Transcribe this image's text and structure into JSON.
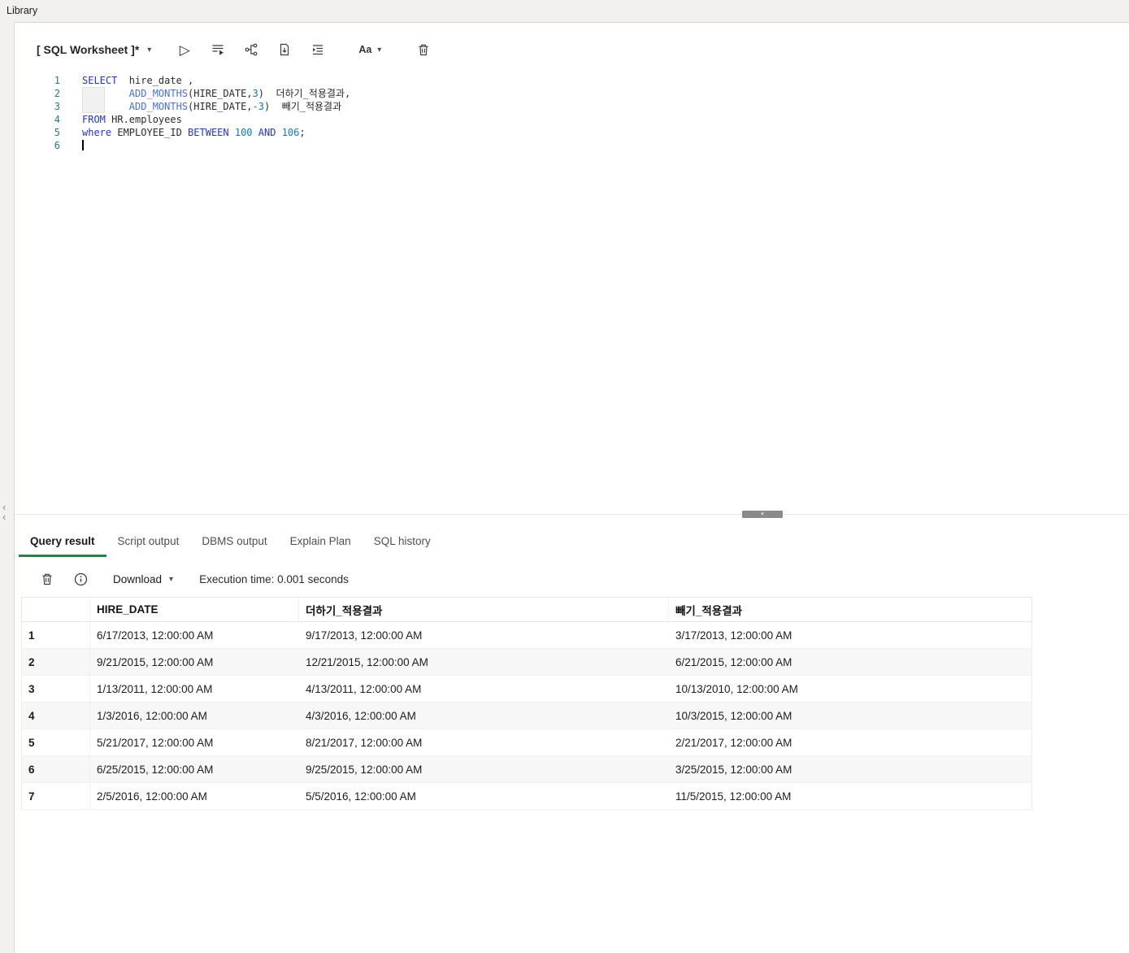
{
  "app": {
    "library_label": "Library"
  },
  "colors": {
    "accent_green": "#2f7d4e",
    "editor_keyword": "#2334cc",
    "editor_function": "#4a6ee0",
    "editor_number": "#0d79c4",
    "editor_line_number": "#237893"
  },
  "worksheet": {
    "title": "[ SQL Worksheet ]*",
    "icons": {
      "caret": "▾",
      "run": "▷",
      "aa_label": "Aa",
      "collapse": "‹",
      "splitter_chevron": "▾"
    },
    "editor": {
      "lines": [
        [
          {
            "t": "kw",
            "s": "SELECT"
          },
          {
            "t": "p",
            "s": "  hire_date ,"
          }
        ],
        [
          {
            "t": "p",
            "s": "        "
          },
          {
            "t": "fn",
            "s": "ADD_MONTHS"
          },
          {
            "t": "p",
            "s": "(HIRE_DATE,"
          },
          {
            "t": "num",
            "s": "3"
          },
          {
            "t": "p",
            "s": ")  더하기_적용결과,"
          }
        ],
        [
          {
            "t": "p",
            "s": "        "
          },
          {
            "t": "fn",
            "s": "ADD_MONTHS"
          },
          {
            "t": "p",
            "s": "(HIRE_DATE,"
          },
          {
            "t": "num",
            "s": "-3"
          },
          {
            "t": "p",
            "s": ")  빼기_적용결과"
          }
        ],
        [
          {
            "t": "kw",
            "s": "FROM"
          },
          {
            "t": "p",
            "s": " HR.employees"
          }
        ],
        [
          {
            "t": "kw",
            "s": "where"
          },
          {
            "t": "p",
            "s": " EMPLOYEE_ID "
          },
          {
            "t": "kw",
            "s": "BETWEEN"
          },
          {
            "t": "p",
            "s": " "
          },
          {
            "t": "num",
            "s": "100"
          },
          {
            "t": "p",
            "s": " "
          },
          {
            "t": "kw",
            "s": "AND"
          },
          {
            "t": "p",
            "s": " "
          },
          {
            "t": "num",
            "s": "106"
          },
          {
            "t": "p",
            "s": ";"
          }
        ],
        []
      ]
    }
  },
  "results": {
    "tabs": [
      {
        "label": "Query result",
        "active": true
      },
      {
        "label": "Script output",
        "active": false
      },
      {
        "label": "DBMS output",
        "active": false
      },
      {
        "label": "Explain Plan",
        "active": false
      },
      {
        "label": "SQL history",
        "active": false
      }
    ],
    "toolbar": {
      "download_label": "Download",
      "execution_time": "Execution time: 0.001 seconds"
    },
    "table": {
      "columns": [
        "HIRE_DATE",
        "더하기_적용결과",
        "빼기_적용결과"
      ],
      "rows": [
        [
          "1",
          "6/17/2013, 12:00:00 AM",
          "9/17/2013, 12:00:00 AM",
          "3/17/2013, 12:00:00 AM"
        ],
        [
          "2",
          "9/21/2015, 12:00:00 AM",
          "12/21/2015, 12:00:00 AM",
          "6/21/2015, 12:00:00 AM"
        ],
        [
          "3",
          "1/13/2011, 12:00:00 AM",
          "4/13/2011, 12:00:00 AM",
          "10/13/2010, 12:00:00 AM"
        ],
        [
          "4",
          "1/3/2016, 12:00:00 AM",
          "4/3/2016, 12:00:00 AM",
          "10/3/2015, 12:00:00 AM"
        ],
        [
          "5",
          "5/21/2017, 12:00:00 AM",
          "8/21/2017, 12:00:00 AM",
          "2/21/2017, 12:00:00 AM"
        ],
        [
          "6",
          "6/25/2015, 12:00:00 AM",
          "9/25/2015, 12:00:00 AM",
          "3/25/2015, 12:00:00 AM"
        ],
        [
          "7",
          "2/5/2016, 12:00:00 AM",
          "5/5/2016, 12:00:00 AM",
          "11/5/2015, 12:00:00 AM"
        ]
      ]
    }
  }
}
